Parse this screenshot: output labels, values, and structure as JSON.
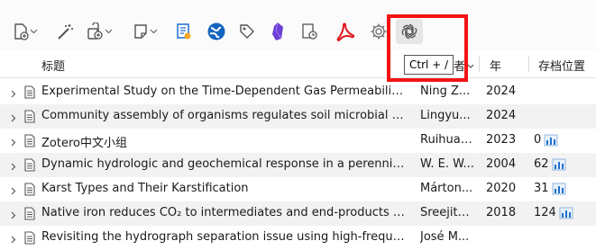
{
  "toolbar": {
    "icons": [
      "new-item-icon",
      "magic-wand-icon",
      "add-attachment-icon",
      "new-note-icon",
      "sync-notes-icon",
      "world-globe-icon",
      "tag-icon",
      "obsidian-icon",
      "history-icon",
      "pdf-icon",
      "gear-icon",
      "openai-icon"
    ]
  },
  "tooltip": {
    "text": "Ctrl + /"
  },
  "columns": {
    "title": "标题",
    "creator": "作者",
    "year": "年",
    "attachments": "存档位置"
  },
  "rows": [
    {
      "title": "Experimental Study on the Time-Dependent Gas Permeability ...",
      "creator": "Ning Z...",
      "year": "2024",
      "count": ""
    },
    {
      "title": "Community assembly of organisms regulates soil microbial fun...",
      "creator": "Lingyu...",
      "year": "2024",
      "count": ""
    },
    {
      "title": "Zotero中文小组",
      "creator": "Ruihua ...",
      "year": "2023",
      "count": "0"
    },
    {
      "title": "Dynamic hydrologic and geochemical response in a perennial ...",
      "creator": "W. E. W...",
      "year": "2004",
      "count": "62"
    },
    {
      "title": "Karst Types and Their Karstification",
      "creator": "Márton...",
      "year": "2020",
      "count": "31"
    },
    {
      "title": "Native iron reduces CO₂ to intermediates and end-products of ...",
      "creator": "Sreejith...",
      "year": "2018",
      "count": "124"
    },
    {
      "title": "Revisiting the hydrograph separation issue using high-frequen...",
      "creator": "José M...",
      "year": "",
      "count": ""
    }
  ],
  "colors": {
    "highlight": "#fde6ea",
    "accent_red": "#f31313",
    "row_alt": "#f2f2f2"
  }
}
